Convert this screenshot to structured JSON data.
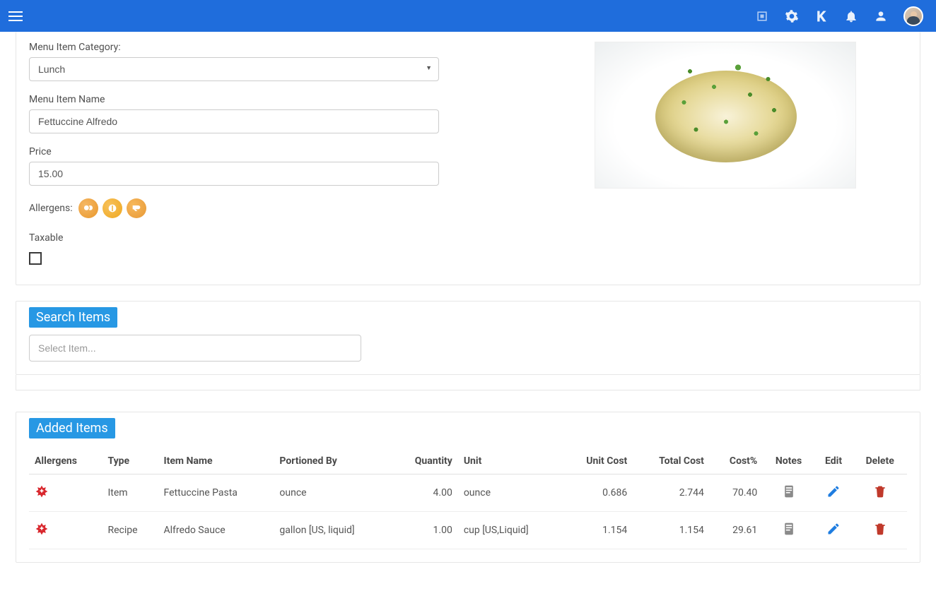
{
  "topbar": {
    "icons": [
      "square-icon",
      "settings-icon",
      "logo-k-icon",
      "bell-icon",
      "user-icon",
      "avatar"
    ]
  },
  "form": {
    "category_label": "Menu Item Category:",
    "category_value": "Lunch",
    "name_label": "Menu Item Name",
    "name_value": "Fettuccine Alfredo",
    "price_label": "Price",
    "price_value": "15.00",
    "allergens_label": "Allergens:",
    "taxable_label": "Taxable",
    "taxable_checked": false
  },
  "search": {
    "title": "Search Items",
    "placeholder": "Select Item..."
  },
  "added": {
    "title": "Added Items",
    "columns": {
      "allergens": "Allergens",
      "type": "Type",
      "item_name": "Item Name",
      "portioned_by": "Portioned By",
      "quantity": "Quantity",
      "unit": "Unit",
      "unit_cost": "Unit Cost",
      "total_cost": "Total Cost",
      "cost_pct": "Cost%",
      "notes": "Notes",
      "edit": "Edit",
      "delete": "Delete"
    },
    "rows": [
      {
        "type": "Item",
        "item_name": "Fettuccine Pasta",
        "portioned_by": "ounce",
        "quantity": "4.00",
        "unit": "ounce",
        "unit_cost": "0.686",
        "total_cost": "2.744",
        "cost_pct": "70.40"
      },
      {
        "type": "Recipe",
        "item_name": "Alfredo Sauce",
        "portioned_by": "gallon [US, liquid]",
        "quantity": "1.00",
        "unit": "cup [US,Liquid]",
        "unit_cost": "1.154",
        "total_cost": "1.154",
        "cost_pct": "29.61"
      }
    ]
  },
  "colors": {
    "primary": "#1f6ddc",
    "badge": "#2798e4",
    "danger": "#c0392b",
    "edit": "#1f7de0"
  }
}
